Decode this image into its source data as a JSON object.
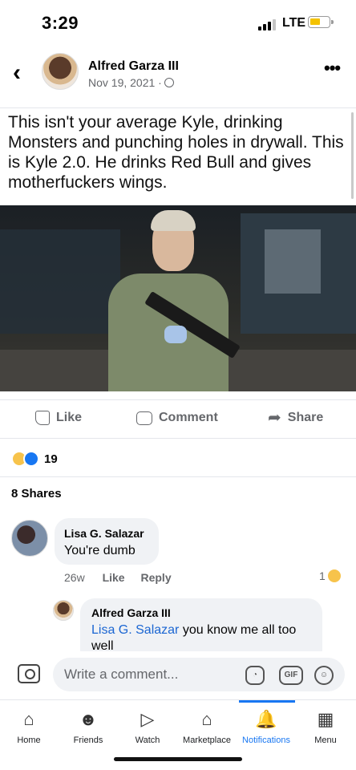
{
  "status_bar": {
    "time": "3:29",
    "network": "LTE"
  },
  "post": {
    "author": "Alfred Garza III",
    "date": "Nov 19, 2021 ·",
    "caption": "This isn't your average Kyle, drinking Monsters and punching holes in drywall. This is Kyle 2.0. He drinks Red Bull and gives motherfuckers wings.",
    "photo_icon": "photo-of-man-with-rifle"
  },
  "actions": {
    "like": "Like",
    "comment": "Comment",
    "share": "Share"
  },
  "reactions": {
    "count": "19"
  },
  "shares": "8 Shares",
  "comments": [
    {
      "author": "Lisa G. Salazar",
      "text": "You're dumb",
      "time": "26w",
      "like": "Like",
      "reply": "Reply",
      "reaction_count": "1"
    },
    {
      "author": "Alfred Garza III",
      "mention": "Lisa G. Salazar",
      "text": " you know me all too well"
    }
  ],
  "composer": {
    "placeholder": "Write a comment...",
    "gif": "GIF"
  },
  "tabbar": {
    "home": "Home",
    "friends": "Friends",
    "watch": "Watch",
    "marketplace": "Marketplace",
    "notifications": "Notifications",
    "menu": "Menu"
  },
  "colors": {
    "accent": "#1877f2",
    "link": "#1b66d2",
    "bubble": "#f0f2f5"
  }
}
